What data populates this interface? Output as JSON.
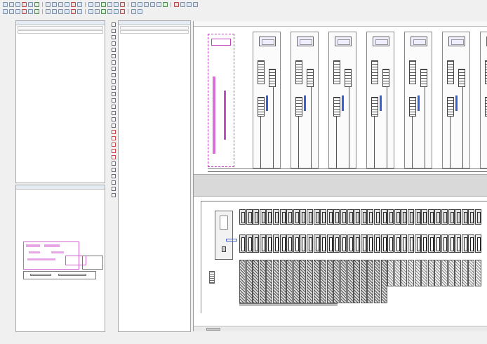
{
  "toolbar": {
    "row1_icons": [
      "new-icon",
      "open-icon",
      "save-icon",
      "print-icon",
      "undo-icon",
      "redo-icon",
      "cut-icon",
      "copy-icon",
      "paste-icon",
      "zoom-in-icon",
      "zoom-out-icon",
      "zoom-fit-icon",
      "grid-icon",
      "snap-icon",
      "line-icon",
      "rect-icon",
      "text-icon",
      "symbol-icon",
      "wire-icon",
      "bus-icon",
      "terminal-icon",
      "cable-icon",
      "connector-icon",
      "device-icon",
      "plc-icon",
      "report-icon",
      "check-icon",
      "help-icon"
    ],
    "row2_icons": [
      "select-icon",
      "pan-icon",
      "rotate-icon",
      "mirror-icon",
      "align-left-icon",
      "align-right-icon",
      "align-top-icon",
      "align-bottom-icon",
      "group-icon",
      "ungroup-icon",
      "layer-icon",
      "properties-icon",
      "find-icon",
      "replace-icon",
      "measure-icon",
      "dimension-icon",
      "hatch-icon",
      "arc-icon",
      "circle-icon",
      "polyline-icon"
    ]
  },
  "left_panel": {
    "title": "",
    "filter_label": "",
    "tree": [],
    "tabs": []
  },
  "preview_panel": {
    "title": ""
  },
  "mid_panel": {
    "title": "",
    "tree": [],
    "tabs": []
  },
  "canvas": {
    "column_marks": [],
    "drive_count": 7,
    "plc_slot_count": 36
  },
  "colors": {
    "accent": "#3a7bd5",
    "pink": "#c040c0",
    "blue_label": "#3a5fd0"
  }
}
